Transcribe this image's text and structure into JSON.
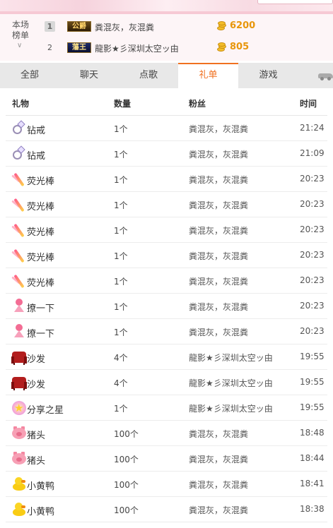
{
  "ranking": {
    "label": "本场榜单",
    "entries": [
      {
        "rank": "1",
        "badge": "公爵",
        "name": "粪混灰，灰混粪",
        "score": "6200"
      },
      {
        "rank": "2",
        "badge": "藩王",
        "name": "龍影★彡深圳太空ッ由",
        "score": "805"
      }
    ]
  },
  "tabs": [
    "全部",
    "聊天",
    "点歌",
    "礼单",
    "游戏"
  ],
  "active_tab": "礼单",
  "table": {
    "headers": {
      "gift": "礼物",
      "qty": "数量",
      "fan": "粉丝",
      "time": "时间"
    },
    "rows": [
      {
        "icon": "ring-icon",
        "gift": "钻戒",
        "qty": "1个",
        "fan": "粪混灰，灰混粪",
        "time": "21:24"
      },
      {
        "icon": "ring-icon",
        "gift": "钻戒",
        "qty": "1个",
        "fan": "粪混灰，灰混粪",
        "time": "21:09"
      },
      {
        "icon": "glowstick-icon",
        "gift": "荧光棒",
        "qty": "1个",
        "fan": "粪混灰，灰混粪",
        "time": "20:23"
      },
      {
        "icon": "glowstick-icon",
        "gift": "荧光棒",
        "qty": "1个",
        "fan": "粪混灰，灰混粪",
        "time": "20:23"
      },
      {
        "icon": "glowstick-icon",
        "gift": "荧光棒",
        "qty": "1个",
        "fan": "粪混灰，灰混粪",
        "time": "20:23"
      },
      {
        "icon": "glowstick-icon",
        "gift": "荧光棒",
        "qty": "1个",
        "fan": "粪混灰，灰混粪",
        "time": "20:23"
      },
      {
        "icon": "glowstick-icon",
        "gift": "荧光棒",
        "qty": "1个",
        "fan": "粪混灰，灰混粪",
        "time": "20:23"
      },
      {
        "icon": "flirt-icon",
        "gift": "撩一下",
        "qty": "1个",
        "fan": "粪混灰，灰混粪",
        "time": "20:23"
      },
      {
        "icon": "flirt-icon",
        "gift": "撩一下",
        "qty": "1个",
        "fan": "粪混灰，灰混粪",
        "time": "20:23"
      },
      {
        "icon": "sofa-icon",
        "gift": "沙发",
        "qty": "4个",
        "fan": "龍影★彡深圳太空ッ由",
        "time": "19:55"
      },
      {
        "icon": "sofa-icon",
        "gift": "沙发",
        "qty": "4个",
        "fan": "龍影★彡深圳太空ッ由",
        "time": "19:55"
      },
      {
        "icon": "star-icon",
        "gift": "分享之星",
        "qty": "1个",
        "fan": "龍影★彡深圳太空ッ由",
        "time": "19:55"
      },
      {
        "icon": "pig-icon",
        "gift": "猪头",
        "qty": "100个",
        "fan": "粪混灰，灰混粪",
        "time": "18:48"
      },
      {
        "icon": "pig-icon",
        "gift": "猪头",
        "qty": "100个",
        "fan": "粪混灰，灰混粪",
        "time": "18:44"
      },
      {
        "icon": "duck-icon",
        "gift": "小黄鸭",
        "qty": "100个",
        "fan": "粪混灰，灰混粪",
        "time": "18:41"
      },
      {
        "icon": "duck-icon",
        "gift": "小黄鸭",
        "qty": "100个",
        "fan": "粪混灰，灰混粪",
        "time": "18:38"
      }
    ]
  },
  "colors": {
    "accent": "#f07020",
    "score": "#e8960b"
  }
}
